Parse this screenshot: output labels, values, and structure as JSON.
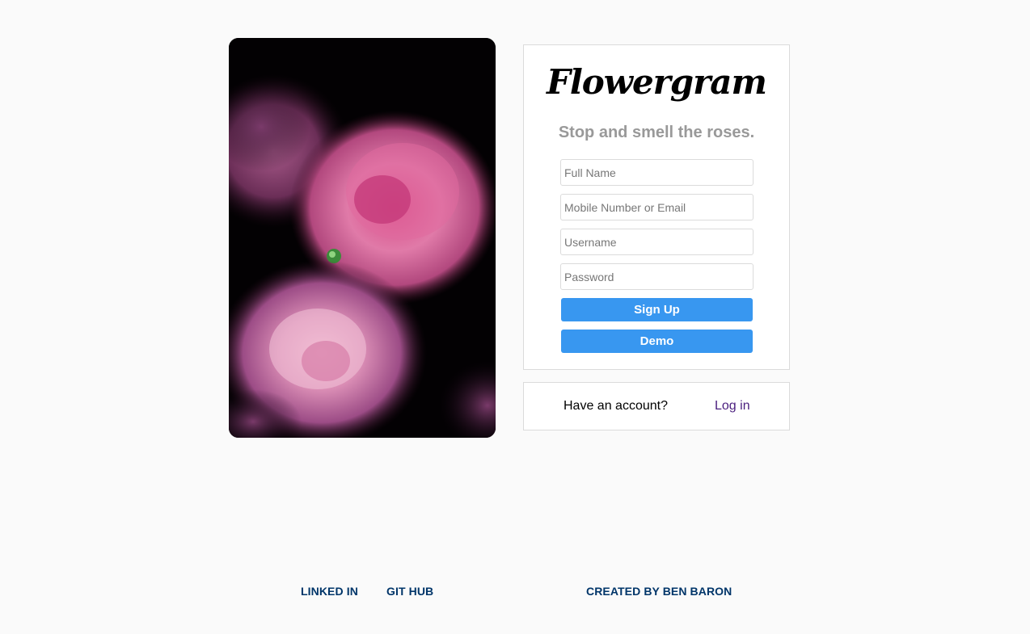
{
  "photo": {
    "alt": "pink peony flowers"
  },
  "signup": {
    "logo": "Flowergram",
    "tagline": "Stop and smell the roses.",
    "fields": [
      {
        "placeholder": "Full Name",
        "value": ""
      },
      {
        "placeholder": "Mobile Number or Email",
        "value": ""
      },
      {
        "placeholder": "Username",
        "value": ""
      },
      {
        "placeholder": "Password",
        "value": ""
      }
    ],
    "signup_label": "Sign Up",
    "demo_label": "Demo"
  },
  "login": {
    "prompt": "Have an account?",
    "link_label": "Log in"
  },
  "footer": {
    "linkedin": "LINKED IN",
    "github": "GIT HUB",
    "credit": "CREATED BY BEN BARON"
  },
  "colors": {
    "background": "#fafafa",
    "button": "#3897f0",
    "footer_link": "#003569",
    "login_link": "#4a1e7e",
    "tagline": "#999999"
  }
}
